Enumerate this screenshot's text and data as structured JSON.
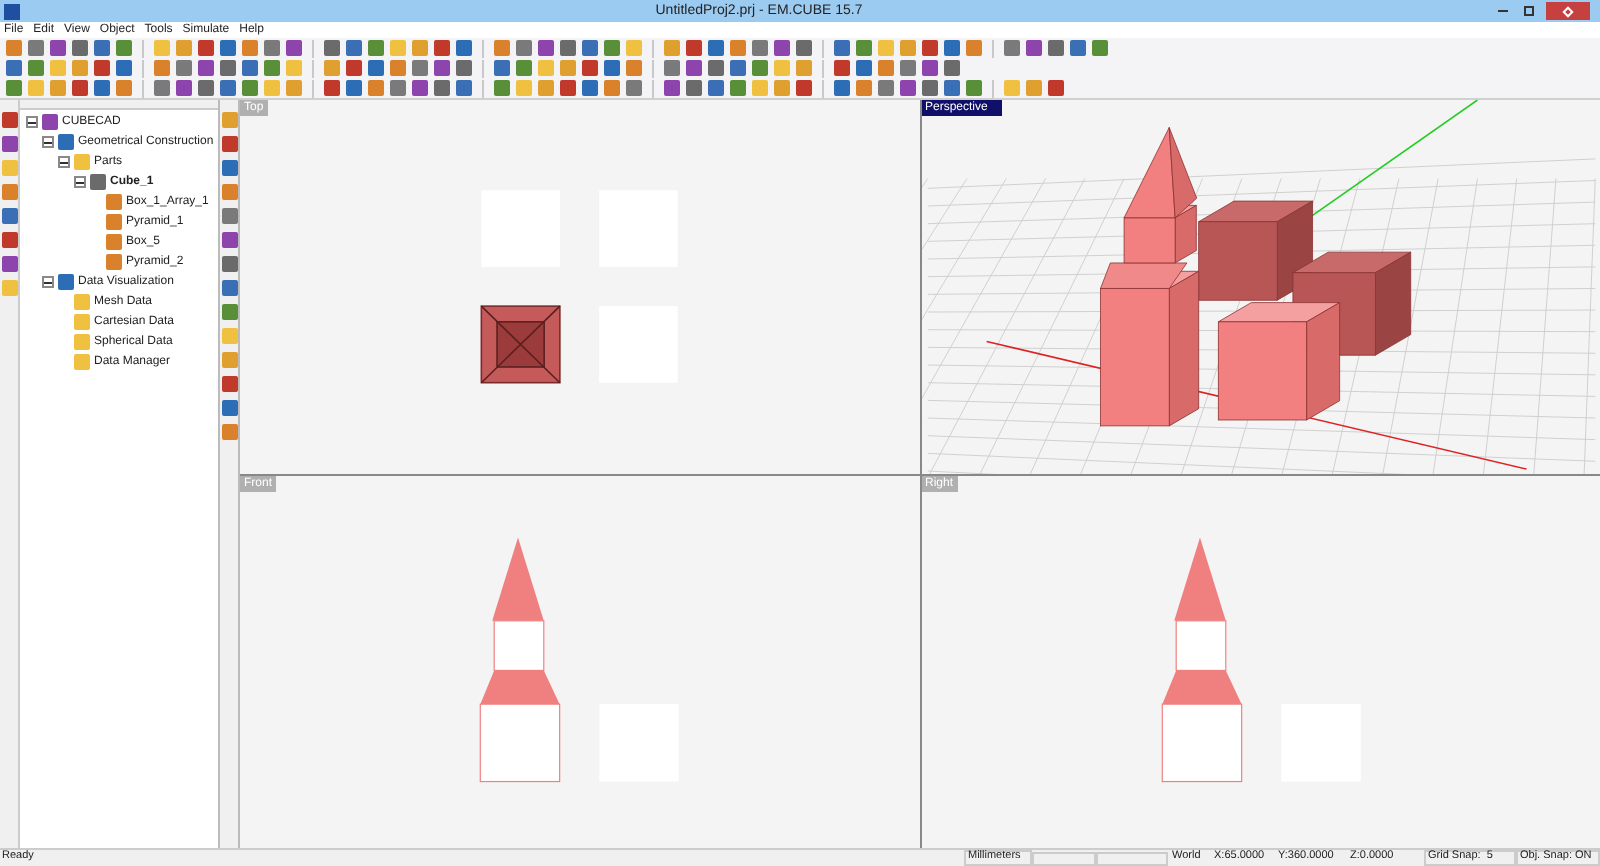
{
  "window": {
    "title": "UntitledProj2.prj - EM.CUBE 15.7"
  },
  "menu": [
    "File",
    "Edit",
    "View",
    "Object",
    "Tools",
    "Simulate",
    "Help"
  ],
  "tree": [
    {
      "label": "CUBECAD",
      "expanded": true,
      "children": [
        {
          "label": "Geometrical Construction",
          "expanded": true,
          "children": [
            {
              "label": "Parts",
              "expanded": true,
              "children": [
                {
                  "label": "Cube_1",
                  "expanded": true,
                  "bold": true,
                  "children": [
                    {
                      "label": "Box_1_Array_1"
                    },
                    {
                      "label": "Pyramid_1"
                    },
                    {
                      "label": "Box_5"
                    },
                    {
                      "label": "Pyramid_2"
                    }
                  ]
                }
              ]
            }
          ]
        },
        {
          "label": "Data Visualization",
          "expanded": true,
          "children": [
            {
              "label": "Mesh Data"
            },
            {
              "label": "Cartesian Data"
            },
            {
              "label": "Spherical Data"
            },
            {
              "label": "Data Manager"
            }
          ]
        }
      ]
    }
  ],
  "viewports": [
    {
      "label": "Top",
      "kind": "top",
      "selected": false
    },
    {
      "label": "Perspective",
      "kind": "perspective",
      "selected": true
    },
    {
      "label": "Front",
      "kind": "front",
      "selected": false
    },
    {
      "label": "Right",
      "kind": "right",
      "selected": false
    }
  ],
  "status_bar": {
    "message": "Ready",
    "units": "Millimeters",
    "frame": "World",
    "x": "X:65.0000",
    "y": "Y:360.0000",
    "z": "Z:0.0000",
    "grid_snap": "Grid Snap:  5",
    "obj_snap": "Obj. Snap: ON"
  }
}
